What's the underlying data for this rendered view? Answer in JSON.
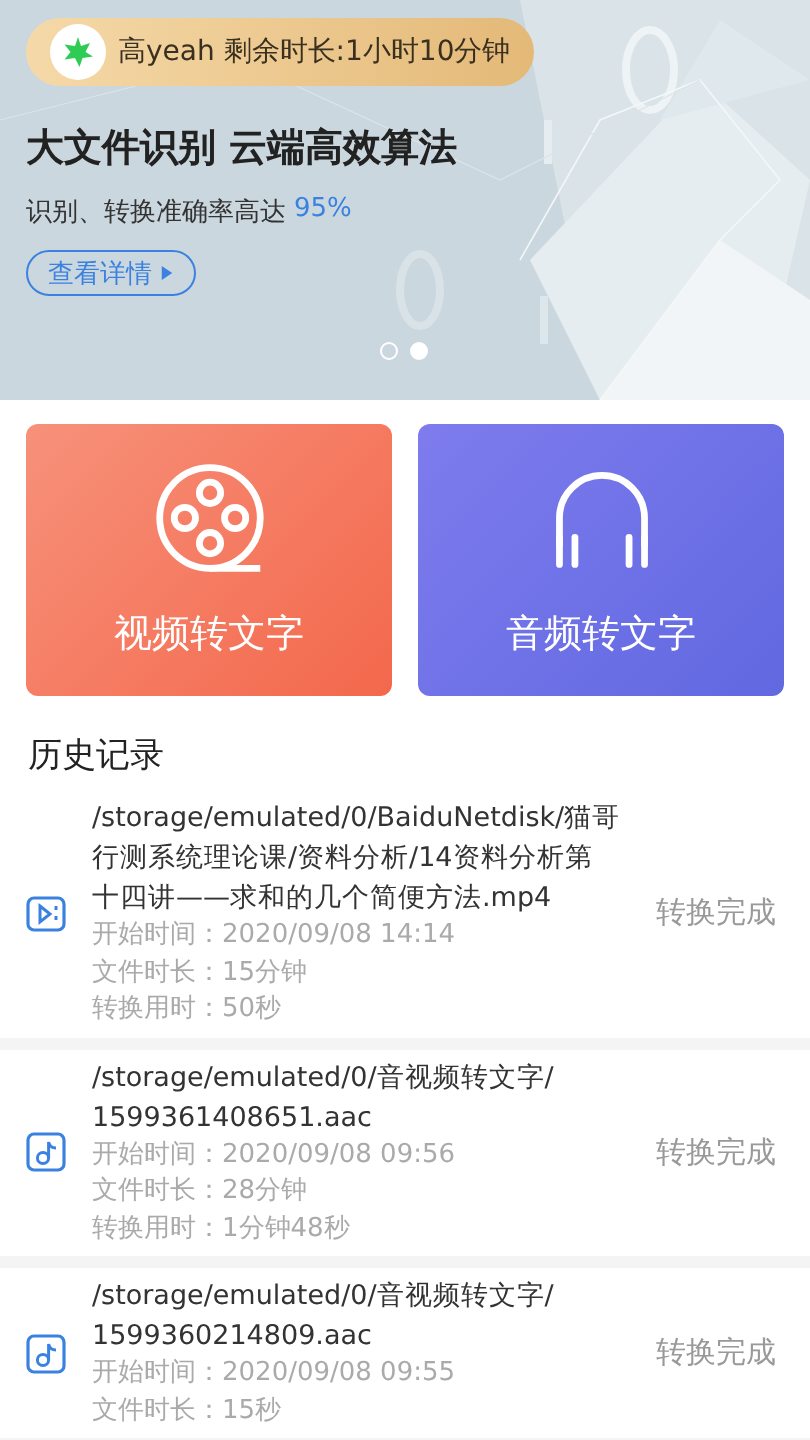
{
  "banner": {
    "account": "高yeah 剩余时长:1小时10分钟",
    "headline": "大文件识别 云端高效算法",
    "subtitle": "识别、转换准确率高达",
    "accuracy": "95%",
    "details_button": "查看详情",
    "pager": [
      {
        "selected": false
      },
      {
        "selected": true
      }
    ]
  },
  "actions": [
    {
      "kind": "video",
      "label": "视频转文字"
    },
    {
      "kind": "audio",
      "label": "音频转文字"
    }
  ],
  "history": {
    "title": "历史记录",
    "items": [
      {
        "kind": "video",
        "path": [
          "/storage/emulated/0/BaiduNetdisk/猫哥",
          "行测系统理论课/资料分析/14资料分析第",
          "十四讲——求和的几个简便方法.mp4"
        ],
        "details": [
          "开始时间：2020/09/08 14:14",
          "文件时长：15分钟",
          "转换用时：50秒"
        ],
        "status": "转换完成"
      },
      {
        "kind": "audio",
        "path": [
          "/storage/emulated/0/音视频转文字/",
          "1599361408651.aac"
        ],
        "details": [
          "开始时间：2020/09/08 09:56",
          "文件时长：28分钟",
          "转换用时：1分钟48秒"
        ],
        "status": "转换完成"
      },
      {
        "kind": "audio",
        "path": [
          "/storage/emulated/0/音视频转文字/",
          "1599360214809.aac"
        ],
        "details": [
          "开始时间：2020/09/08 09:55",
          "文件时长：15秒"
        ],
        "status": "转换完成"
      }
    ]
  }
}
